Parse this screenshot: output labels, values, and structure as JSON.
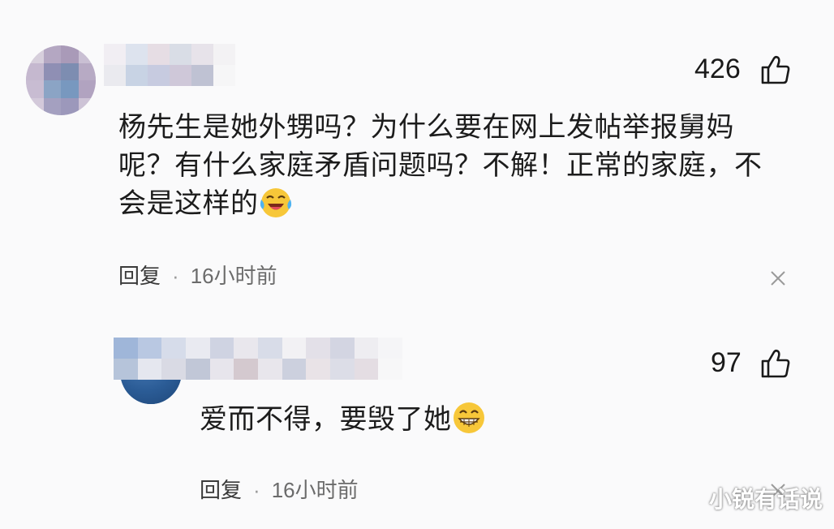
{
  "comments": [
    {
      "likes": "426",
      "text": "杨先生是她外甥吗？为什么要在网上发帖举报舅妈呢？有什么家庭矛盾问题吗？不解！正常的家庭，不会是这样的",
      "emoji": "laughing-crying-emoji",
      "reply_label": "回复",
      "separator": "·",
      "time": "16小时前"
    },
    {
      "likes": "97",
      "text": "爱而不得，要毁了她",
      "emoji": "grinning-emoji",
      "reply_label": "回复",
      "separator": "·",
      "time": "16小时前"
    }
  ],
  "watermark": "小锐有话说",
  "colors": {
    "background": "#fafafb",
    "text": "#1c1c1c",
    "meta": "#6b6b6b",
    "emoji_yellow": "#f7c739"
  }
}
